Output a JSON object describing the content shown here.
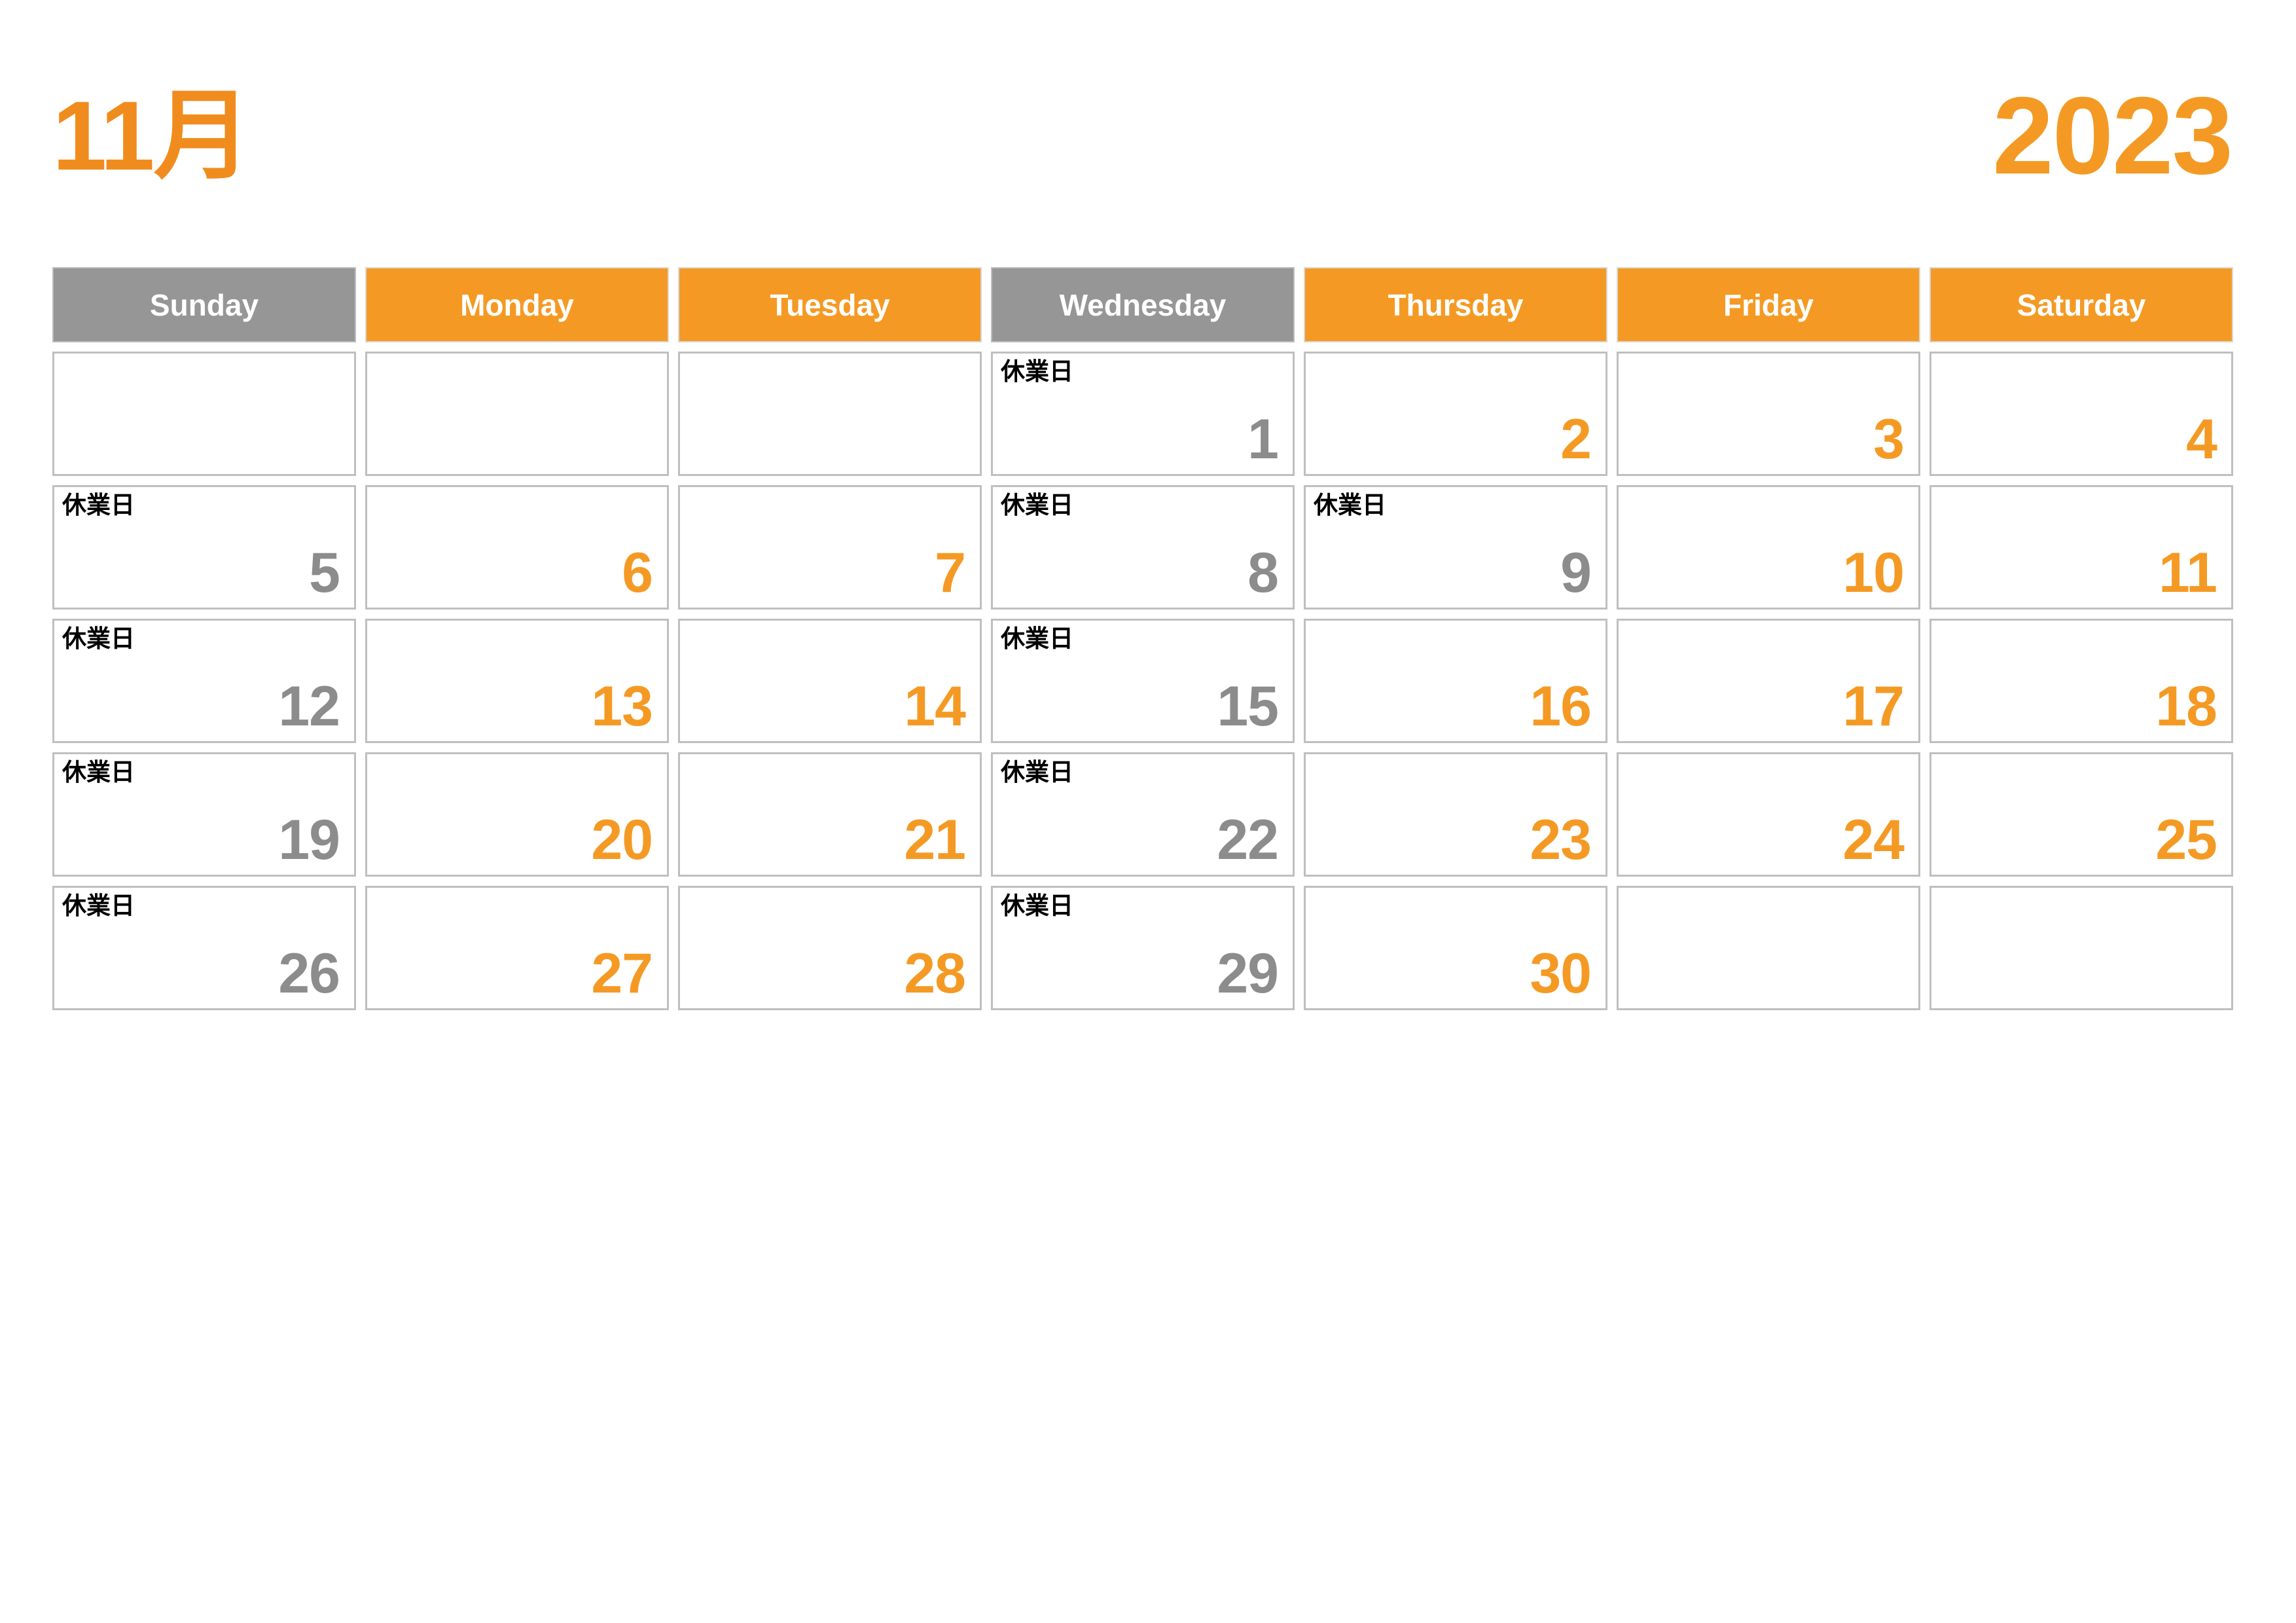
{
  "header": {
    "month_label": "11月",
    "year_label": "2023"
  },
  "colors": {
    "orange": "#F49A24",
    "gray_header": "#969696",
    "gray_number": "#8C8C8C",
    "cell_border": "#BFBFBF",
    "white": "#FFFFFF",
    "black": "#000000"
  },
  "closed_label_text": "休業日",
  "weekdays": [
    {
      "label": "Sunday",
      "tone": "gray"
    },
    {
      "label": "Monday",
      "tone": "orange"
    },
    {
      "label": "Tuesday",
      "tone": "orange"
    },
    {
      "label": "Wednesday",
      "tone": "gray"
    },
    {
      "label": "Thursday",
      "tone": "orange"
    },
    {
      "label": "Friday",
      "tone": "orange"
    },
    {
      "label": "Saturday",
      "tone": "orange"
    }
  ],
  "weeks": [
    [
      {
        "day": "",
        "tone": "",
        "note": ""
      },
      {
        "day": "",
        "tone": "",
        "note": ""
      },
      {
        "day": "",
        "tone": "",
        "note": ""
      },
      {
        "day": "1",
        "tone": "gray",
        "note": "休業日"
      },
      {
        "day": "2",
        "tone": "orange",
        "note": ""
      },
      {
        "day": "3",
        "tone": "orange",
        "note": ""
      },
      {
        "day": "4",
        "tone": "orange",
        "note": ""
      }
    ],
    [
      {
        "day": "5",
        "tone": "gray",
        "note": "休業日"
      },
      {
        "day": "6",
        "tone": "orange",
        "note": ""
      },
      {
        "day": "7",
        "tone": "orange",
        "note": ""
      },
      {
        "day": "8",
        "tone": "gray",
        "note": "休業日"
      },
      {
        "day": "9",
        "tone": "gray",
        "note": "休業日"
      },
      {
        "day": "10",
        "tone": "orange",
        "note": ""
      },
      {
        "day": "11",
        "tone": "orange",
        "note": ""
      }
    ],
    [
      {
        "day": "12",
        "tone": "gray",
        "note": "休業日"
      },
      {
        "day": "13",
        "tone": "orange",
        "note": ""
      },
      {
        "day": "14",
        "tone": "orange",
        "note": ""
      },
      {
        "day": "15",
        "tone": "gray",
        "note": "休業日"
      },
      {
        "day": "16",
        "tone": "orange",
        "note": ""
      },
      {
        "day": "17",
        "tone": "orange",
        "note": ""
      },
      {
        "day": "18",
        "tone": "orange",
        "note": ""
      }
    ],
    [
      {
        "day": "19",
        "tone": "gray",
        "note": "休業日"
      },
      {
        "day": "20",
        "tone": "orange",
        "note": ""
      },
      {
        "day": "21",
        "tone": "orange",
        "note": ""
      },
      {
        "day": "22",
        "tone": "gray",
        "note": "休業日"
      },
      {
        "day": "23",
        "tone": "orange",
        "note": ""
      },
      {
        "day": "24",
        "tone": "orange",
        "note": ""
      },
      {
        "day": "25",
        "tone": "orange",
        "note": ""
      }
    ],
    [
      {
        "day": "26",
        "tone": "gray",
        "note": "休業日"
      },
      {
        "day": "27",
        "tone": "orange",
        "note": ""
      },
      {
        "day": "28",
        "tone": "orange",
        "note": ""
      },
      {
        "day": "29",
        "tone": "gray",
        "note": "休業日"
      },
      {
        "day": "30",
        "tone": "orange",
        "note": ""
      },
      {
        "day": "",
        "tone": "",
        "note": ""
      },
      {
        "day": "",
        "tone": "",
        "note": ""
      }
    ]
  ]
}
